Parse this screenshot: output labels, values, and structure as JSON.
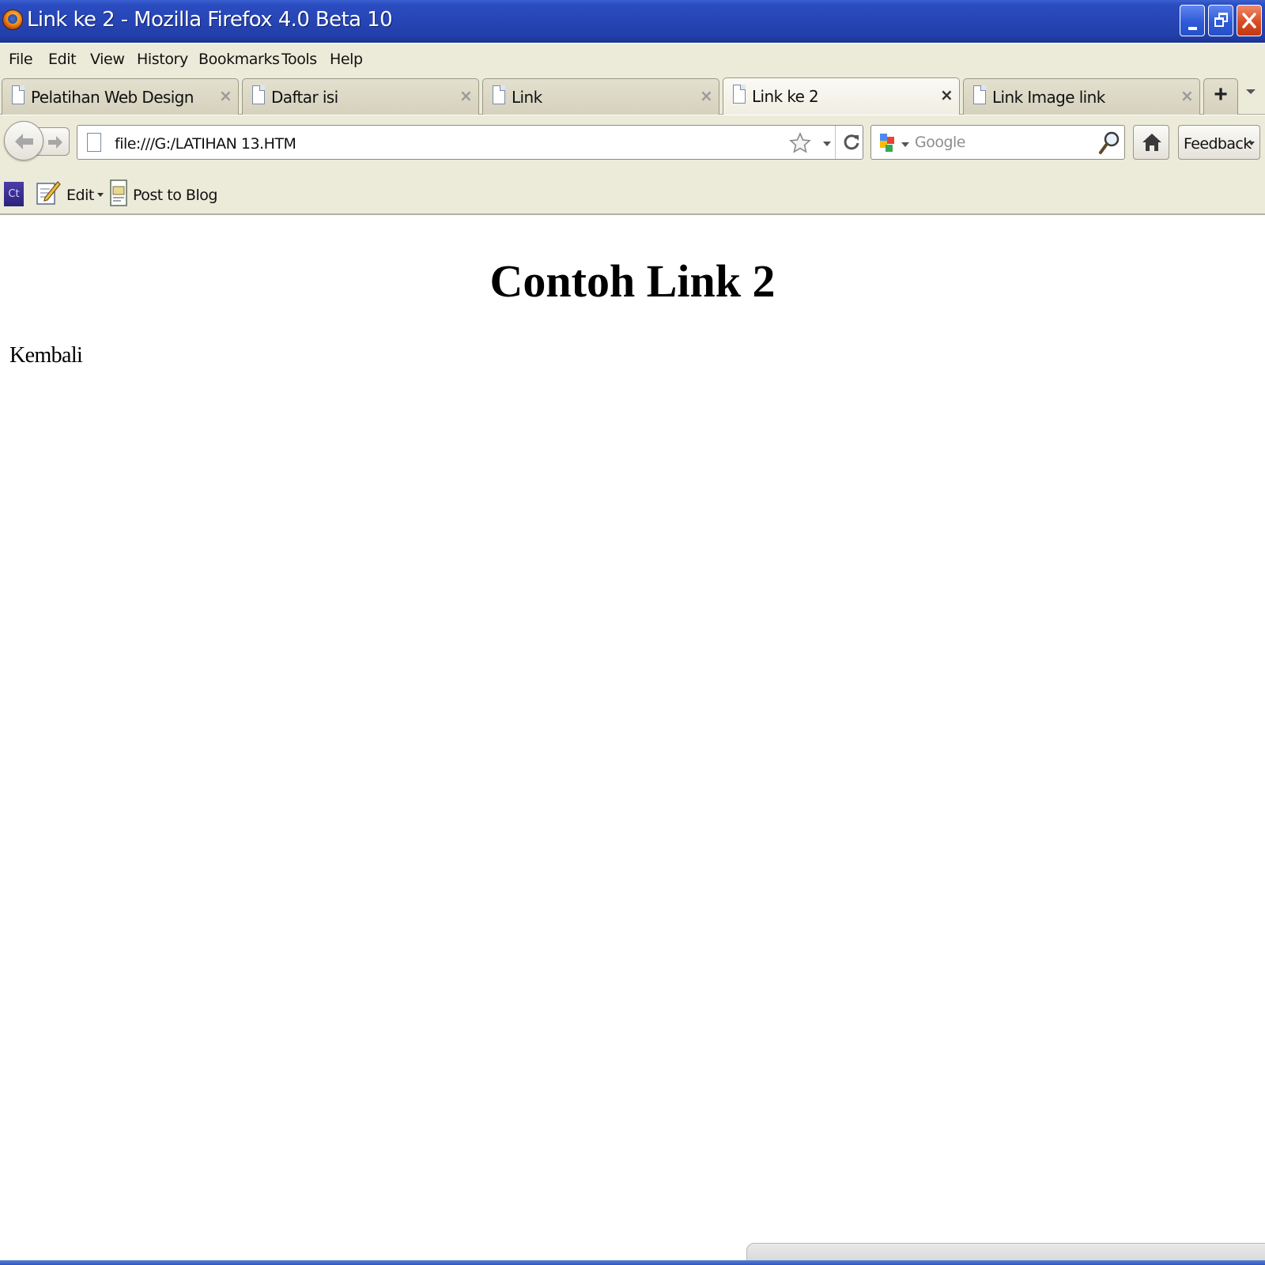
{
  "window": {
    "title": "Link ke 2 - Mozilla Firefox 4.0 Beta 10"
  },
  "menu": {
    "items": [
      "File",
      "Edit",
      "View",
      "History",
      "Bookmarks",
      "Tools",
      "Help"
    ]
  },
  "tabs": [
    {
      "label": "Pelatihan Web Design",
      "active": false
    },
    {
      "label": "Daftar isi",
      "active": false
    },
    {
      "label": "Link",
      "active": false
    },
    {
      "label": "Link ke 2",
      "active": true
    },
    {
      "label": "Link Image link",
      "active": false
    }
  ],
  "tabbar": {
    "close_glyph": "×",
    "new_tab_glyph": "+"
  },
  "navbar": {
    "url": "file:///G:/LATIHAN 13.HTM",
    "search_placeholder": "Google",
    "feedback_label": "Feedback"
  },
  "addon_toolbar": {
    "ct_label": "Ct",
    "edit_label": "Edit",
    "post_label": "Post to Blog"
  },
  "page": {
    "heading": "Contoh Link 2",
    "link_text": "Kembali"
  },
  "icons": {
    "app": "firefox-icon",
    "page": "page-icon",
    "back": "back-arrow-icon",
    "forward": "forward-arrow-icon",
    "bookmark": "star-icon",
    "reload": "reload-icon",
    "search_engine": "google-icon",
    "search": "magnifier-icon",
    "home": "home-icon"
  },
  "colors": {
    "titlebar": "#2745b4",
    "chrome": "#ecead9",
    "close_button": "#d84c24"
  }
}
